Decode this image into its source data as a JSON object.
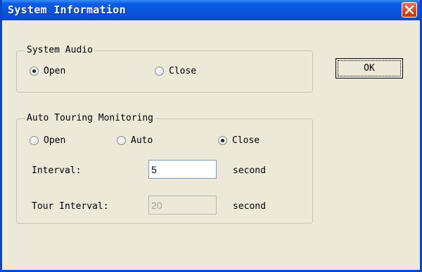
{
  "window": {
    "title": "System Information"
  },
  "icons": {
    "close": "close-icon"
  },
  "colors": {
    "titlebar": "#0a55dd",
    "close_button": "#d8471f",
    "dialog_bg": "#ece9d8"
  },
  "audio_group": {
    "legend": "System Audio",
    "options": [
      {
        "label": "Open",
        "checked": true
      },
      {
        "label": "Close",
        "checked": false
      }
    ]
  },
  "touring_group": {
    "legend": "Auto Touring Monitoring",
    "options": [
      {
        "label": "Open",
        "checked": false
      },
      {
        "label": "Auto",
        "checked": false
      },
      {
        "label": "Close",
        "checked": true
      }
    ],
    "interval_label": "Interval:",
    "interval_value": "5",
    "interval_unit": "second",
    "tour_interval_label": "Tour Interval:",
    "tour_interval_value": "20",
    "tour_interval_unit": "second"
  },
  "buttons": {
    "ok": "OK"
  }
}
